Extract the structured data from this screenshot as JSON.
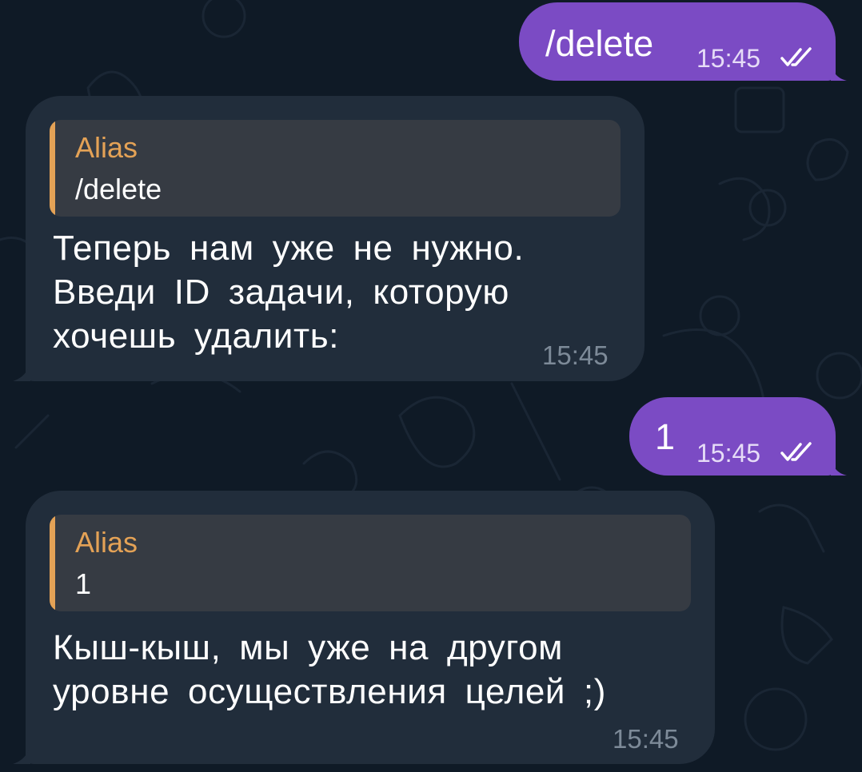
{
  "colors": {
    "background": "#0f1a26",
    "outgoing_bubble": "#7b4bc4",
    "incoming_bubble": "#212d3b",
    "reply_accent": "#e4a256",
    "reply_background": "#363b43",
    "timestamp_incoming": "#7d8a98"
  },
  "messages": [
    {
      "direction": "outgoing",
      "text": "/delete",
      "time": "15:45",
      "status": "read",
      "status_icon": "double-check-icon"
    },
    {
      "direction": "incoming",
      "reply_to": {
        "author": "Alias",
        "text": "/delete"
      },
      "text": "Теперь нам уже не нужно.\nВведи ID задачи, которую\nхочешь удалить:",
      "time": "15:45"
    },
    {
      "direction": "outgoing",
      "text": "1",
      "time": "15:45",
      "status": "read",
      "status_icon": "double-check-icon"
    },
    {
      "direction": "incoming",
      "reply_to": {
        "author": "Alias",
        "text": "1"
      },
      "text": "Кыш-кыш, мы уже на другом\nуровне осуществления целей ;)",
      "time": "15:45"
    }
  ]
}
